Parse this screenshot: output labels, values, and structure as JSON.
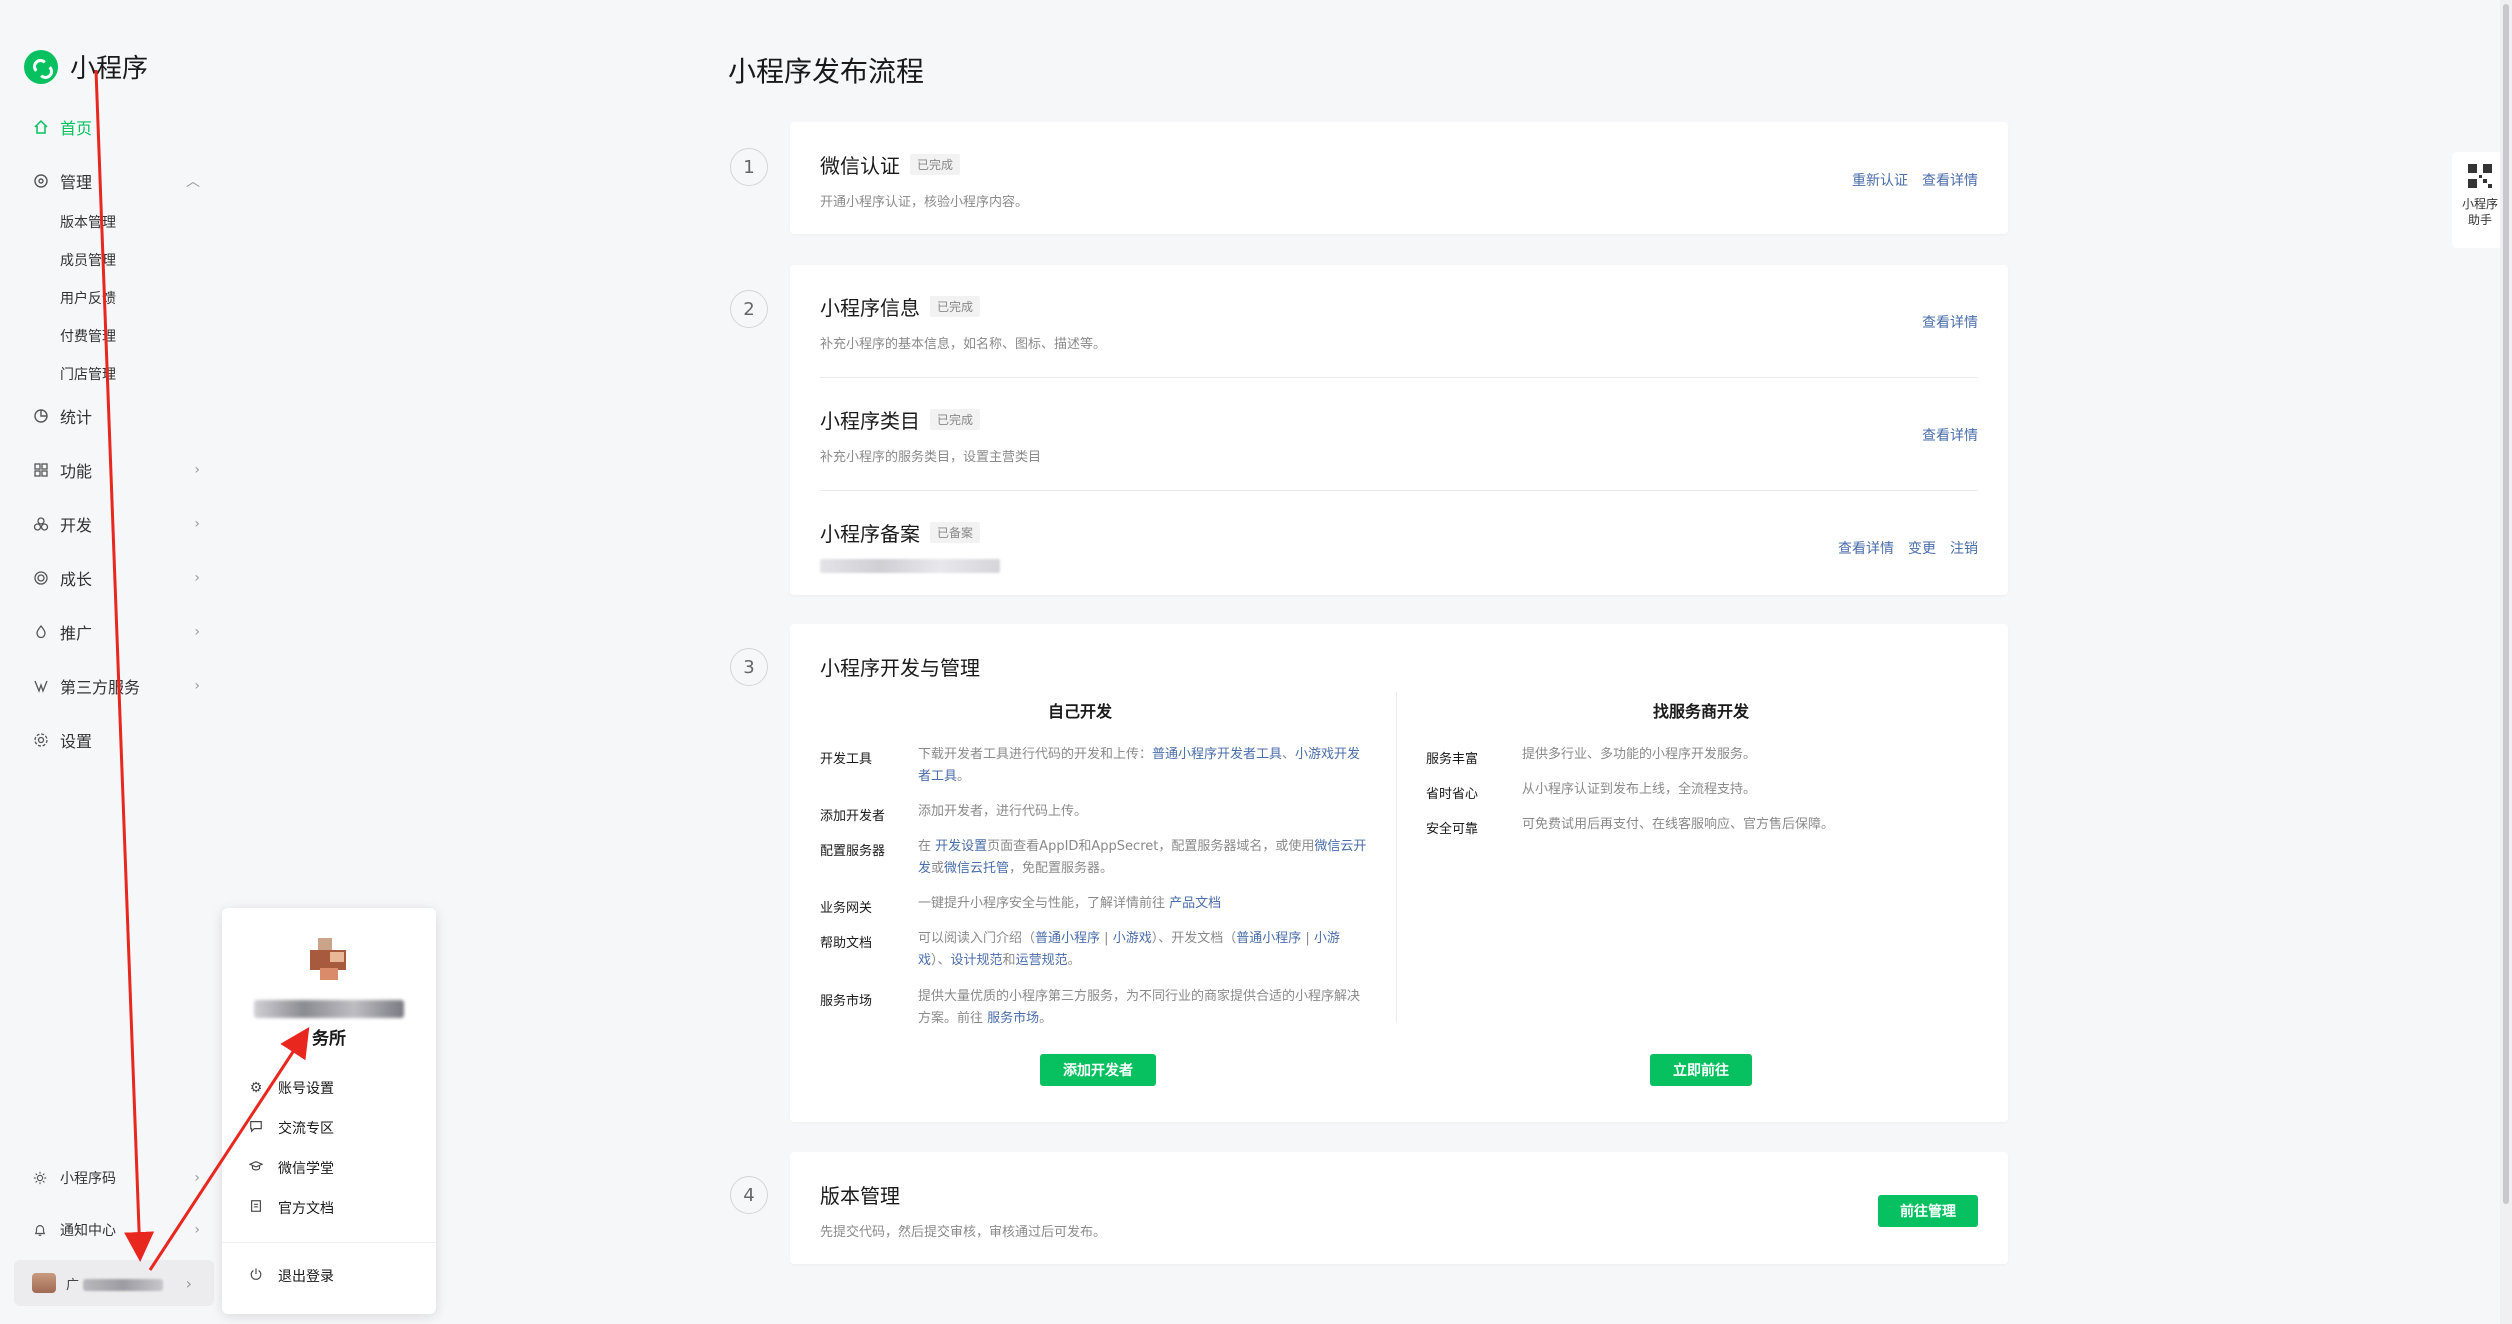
{
  "app": {
    "name": "小程序"
  },
  "sidebar": {
    "home": "首页",
    "manage": "管理",
    "manage_sub": [
      "版本管理",
      "成员管理",
      "用户反馈",
      "付费管理",
      "门店管理"
    ],
    "stats": "统计",
    "feature": "功能",
    "dev": "开发",
    "growth": "成长",
    "promo": "推广",
    "third_party": "第三方服务",
    "settings": "设置",
    "bottom": {
      "qrcode": "小程序码",
      "notify": "通知中心",
      "account_prefix": "广"
    }
  },
  "popup": {
    "name_suffix": "务所",
    "items": [
      "账号设置",
      "交流专区",
      "微信学堂",
      "官方文档"
    ],
    "logout": "退出登录"
  },
  "main": {
    "title": "小程序发布流程",
    "step1": {
      "num": "1",
      "title": "微信认证",
      "badge": "已完成",
      "desc": "开通小程序认证，核验小程序内容。",
      "links": [
        "重新认证",
        "查看详情"
      ]
    },
    "step2": {
      "num": "2",
      "info": {
        "title": "小程序信息",
        "badge": "已完成",
        "desc": "补充小程序的基本信息，如名称、图标、描述等。",
        "link": "查看详情"
      },
      "category": {
        "title": "小程序类目",
        "badge": "已完成",
        "desc": "补充小程序的服务类目，设置主营类目",
        "link": "查看详情"
      },
      "filing": {
        "title": "小程序备案",
        "badge": "已备案",
        "links": [
          "查看详情",
          "变更",
          "注销"
        ]
      }
    },
    "step3": {
      "num": "3",
      "title": "小程序开发与管理",
      "self_dev": {
        "heading": "自己开发",
        "rows": [
          {
            "label": "开发工具",
            "text": "下载开发者工具进行代码的开发和上传：",
            "link1": "普通小程序开发者工具",
            "sep": "、",
            "link2": "小游戏开发者工具",
            "end": "。"
          },
          {
            "label": "添加开发者",
            "text": "添加开发者，进行代码上传。"
          },
          {
            "label": "配置服务器",
            "pre": "在",
            "link1": "开发设置",
            "mid": "页面查看AppID和AppSecret，配置服务器域名，或使用",
            "link2": "微信云开发",
            "mid2": "或",
            "link3": "微信云托管",
            "end": "，免配置服务器。"
          },
          {
            "label": "业务网关",
            "text": "一键提升小程序安全与性能，了解详情前往",
            "link1": "产品文档"
          },
          {
            "label": "帮助文档",
            "pre": "可以阅读入门介绍（",
            "link1": "普通小程序",
            "sep1": " | ",
            "link2": "小游戏",
            "mid": "）、开发文档（",
            "link3": "普通小程序",
            "sep2": " | ",
            "link4": "小游戏",
            "mid2": "）、",
            "link5": "设计规范",
            "and": "和",
            "link6": "运营规范",
            "end": "。"
          },
          {
            "label": "服务市场",
            "text": "提供大量优质的小程序第三方服务，为不同行业的商家提供合适的小程序解决方案。前往",
            "link1": "服务市场",
            "end": "。"
          }
        ],
        "button": "添加开发者"
      },
      "vendor_dev": {
        "heading": "找服务商开发",
        "rows": [
          {
            "label": "服务丰富",
            "text": "提供多行业、多功能的小程序开发服务。"
          },
          {
            "label": "省时省心",
            "text": "从小程序认证到发布上线，全流程支持。"
          },
          {
            "label": "安全可靠",
            "text": "可免费试用后再支付、在线客服响应、官方售后保障。"
          }
        ],
        "button": "立即前往"
      }
    },
    "step4": {
      "num": "4",
      "title": "版本管理",
      "desc": "先提交代码，然后提交审核，审核通过后可发布。",
      "button": "前往管理"
    }
  },
  "float_widget": {
    "line1": "小程序",
    "line2": "助手"
  },
  "colors": {
    "accent": "#07c160",
    "link": "#4a6ea9",
    "annotation": "#e8271f"
  }
}
